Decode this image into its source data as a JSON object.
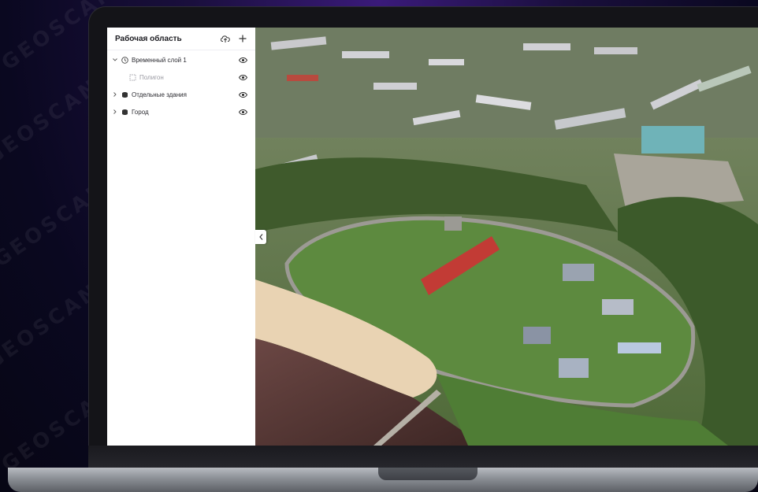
{
  "workspace": {
    "title": "Рабочая область",
    "layers": [
      {
        "label": "Временный слой 1",
        "expanded": true,
        "icon": "clock-icon",
        "children": [
          {
            "label": "Полигон",
            "icon": "polygon-icon"
          }
        ]
      },
      {
        "label": "Отдельные здания",
        "expanded": false,
        "icon": "layers-icon"
      },
      {
        "label": "Город",
        "expanded": false,
        "icon": "layers-icon"
      }
    ]
  },
  "watermark_text": "GEOSCAN",
  "colors": {
    "accent_bg": "#1a0f3d",
    "sidebar_bg": "#ffffff",
    "map_green": "#4f6b3a",
    "water": "#5a3a38",
    "sand": "#e9d3b3",
    "roof_red": "#c23b35"
  }
}
